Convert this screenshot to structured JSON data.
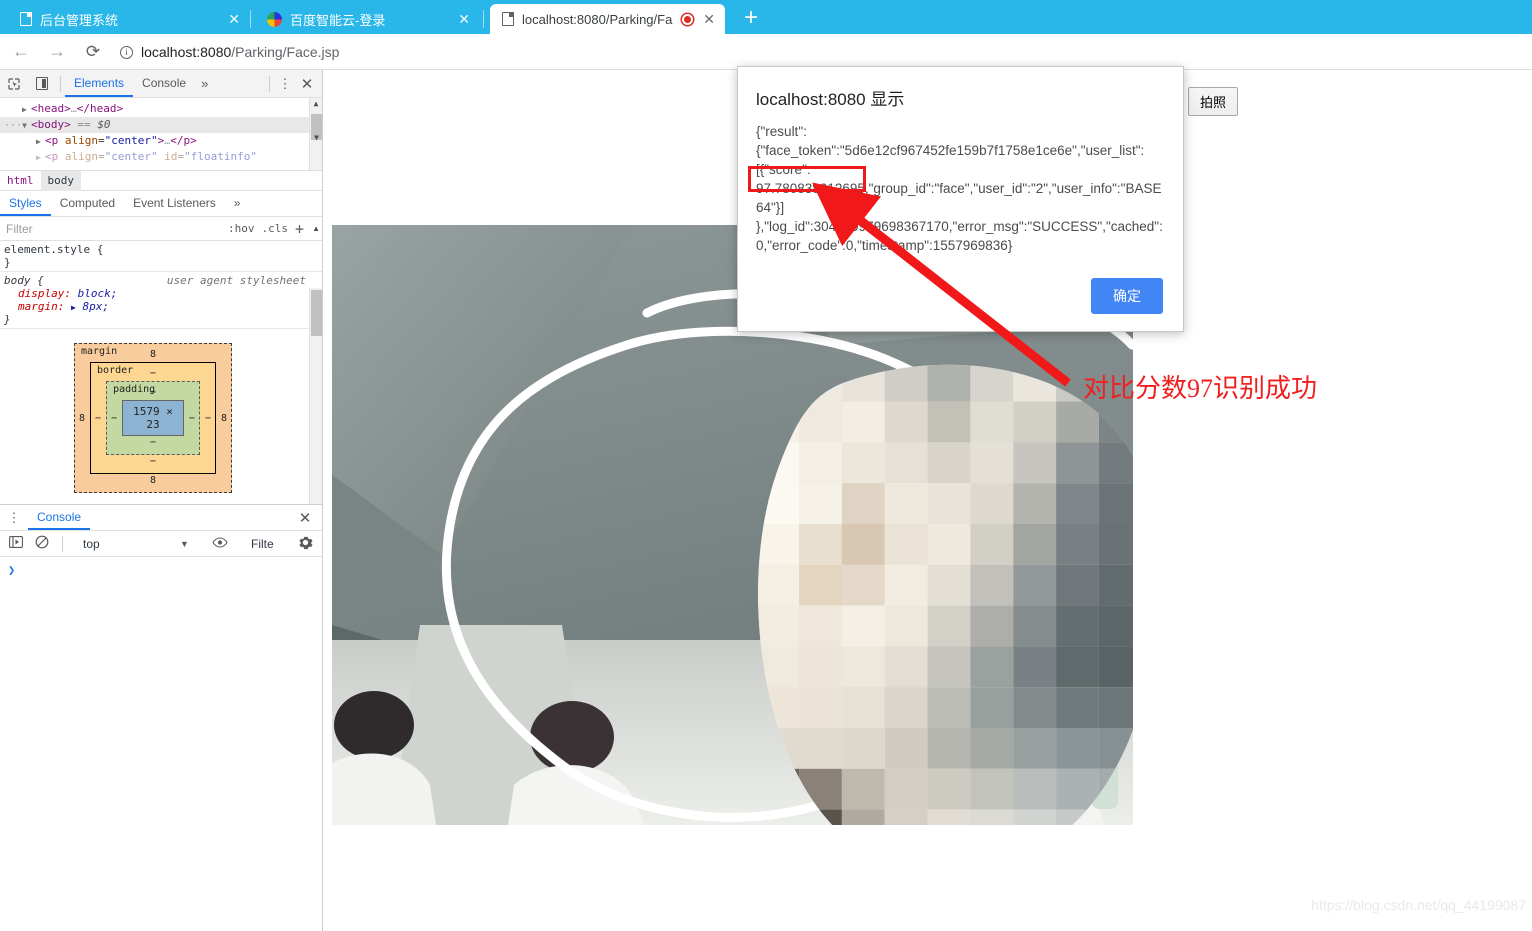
{
  "browser": {
    "tabs": [
      {
        "title": "后台管理系统",
        "icon": "document-icon",
        "active": false
      },
      {
        "title": "百度智能云-登录",
        "icon": "baidu-icon",
        "active": false
      },
      {
        "title": "localhost:8080/Parking/Fa",
        "icon": "document-icon",
        "active": true,
        "recording": true
      }
    ],
    "new_tab_label": "+",
    "close_label": "✕",
    "nav": {
      "back": "←",
      "forward": "→",
      "reload": "C"
    },
    "url_scheme_host": "localhost:8080",
    "url_path": "/Parking/Face.jsp",
    "url_full": "localhost:8080/Parking/Face.jsp"
  },
  "devtools": {
    "toolbar": {
      "inspect_icon": "inspect-element-icon",
      "device_icon": "device-toolbar-icon",
      "tabs": [
        "Elements",
        "Console"
      ],
      "selected_tab": "Elements",
      "more_label": "»",
      "kebab_label": "⋮",
      "close_label": "✕"
    },
    "dom": {
      "rows": [
        {
          "indent": 1,
          "triangle": "▶",
          "text": "<head>…</head>",
          "selected": false
        },
        {
          "indent": 0,
          "triangle": "▼",
          "text": "<body> == $0",
          "selected": true
        },
        {
          "indent": 2,
          "triangle": "▶",
          "text": "<p align=\"center\">…</p>",
          "selected": false
        }
      ],
      "selected_marker": "$0",
      "ellipsis": "…"
    },
    "breadcrumbs": [
      "html",
      "body"
    ],
    "breadcrumb_active": "body",
    "styles_tabs": [
      "Styles",
      "Computed",
      "Event Listeners"
    ],
    "styles_tab_selected": "Styles",
    "styles_more": "»",
    "filter": {
      "placeholder": "Filter",
      "value": "",
      "hov": ":hov",
      "cls": ".cls",
      "plus": "+"
    },
    "rules": [
      {
        "selector": "element.style {",
        "origin": "",
        "declarations": [],
        "close": "}"
      },
      {
        "selector": "body {",
        "origin": "user agent stylesheet",
        "declarations": [
          {
            "property": "display",
            "value": "block;"
          },
          {
            "property": "margin",
            "value": "8px;",
            "expandable": "▶"
          }
        ],
        "close": "}"
      }
    ],
    "box_model": {
      "margin_label": "margin",
      "border_label": "border",
      "padding_label": "padding",
      "content": "1579 × 23",
      "margin_top": "8",
      "margin_right": "8",
      "margin_bottom": "8",
      "margin_left": "8",
      "border_top": "−",
      "border_right": "−",
      "border_bottom": "−",
      "border_left": "−",
      "padding_top": "−",
      "padding_right": "−",
      "padding_bottom": "−",
      "padding_left": "−"
    },
    "drawer": {
      "kebab": "⋮",
      "tab": "Console",
      "close": "✕",
      "execute_icon": "execute-snippet-icon",
      "clear_icon": "clear-console-icon",
      "context": "top",
      "caret": "▼",
      "eye_icon": "live-expression-icon",
      "filter_placeholder": "Filte",
      "gear_icon": "console-settings-icon",
      "prompt": "❯"
    }
  },
  "page": {
    "capture_button": "拍照",
    "annotation": "对比分数97识别成功",
    "watermark": "https://blog.csdn.net/qq_44199087"
  },
  "dialog": {
    "title": "localhost:8080 显示",
    "body": "{\"result\":\n{\"face_token\":\"5d6e12cf967452fe159b7f1758e1ce6e\",\"user_list\":\n[{\"score\":\n97.780838012695,\"group_id\":\"face\",\"user_id\":\"2\",\"user_info\":\"BASE\n64\"}]\n},\"log_id\":304599979698367170,\"error_msg\":\"SUCCESS\",\"cached\":\n0,\"error_code\":0,\"timestamp\":1557969836}",
    "ok_label": "确定",
    "highlight_value": "97.780838012695",
    "highlight_color": "#f01818"
  },
  "colors": {
    "tabstrip": "#29b6e8",
    "accent_blue": "#1a73e8",
    "dialog_button": "#4285f4",
    "annotation_red": "#f02020"
  }
}
